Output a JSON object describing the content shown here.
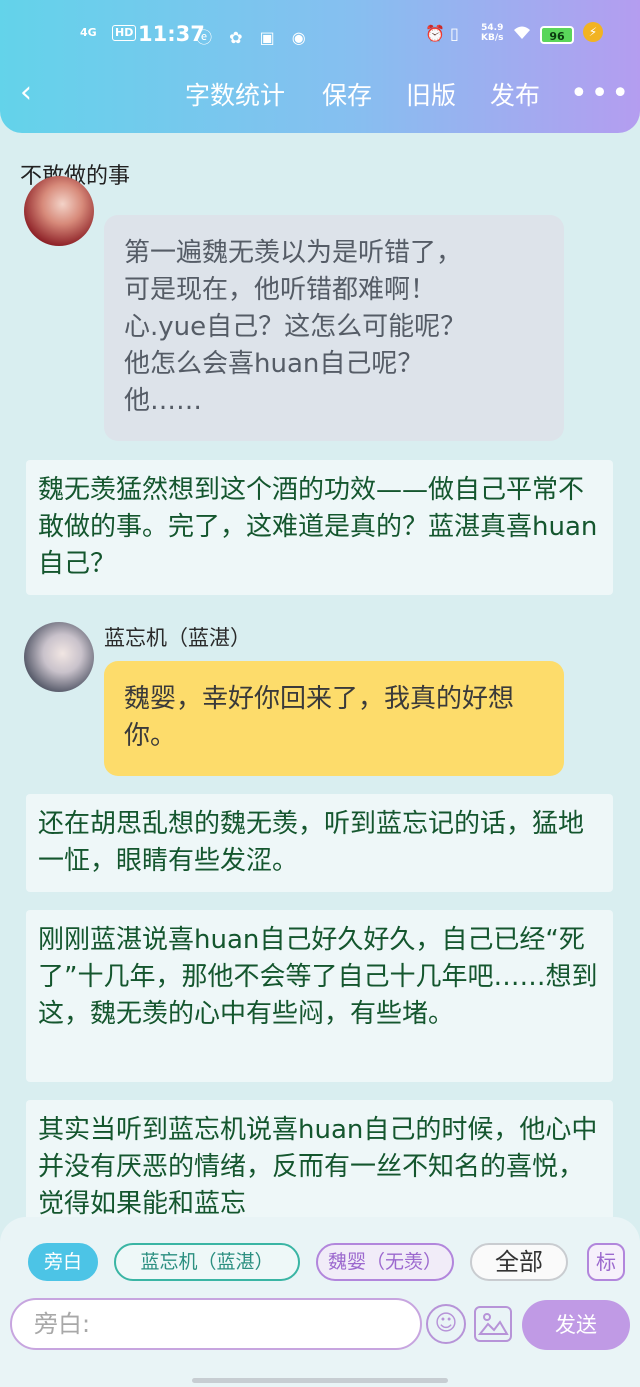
{
  "status_bar": {
    "network": "4G",
    "hd": "HD",
    "time": "11:37",
    "app_icons": "ⓔ ✿ ▣ ◉",
    "speed_value": "54.9",
    "speed_unit": "KB/s",
    "battery": "96"
  },
  "header": {
    "back_icon": "‹",
    "word_count": "字数统计",
    "save": "保存",
    "old_version": "旧版",
    "publish": "发布",
    "more_icon": "•••"
  },
  "document": {
    "title": "不敢做的事"
  },
  "messages": {
    "gray_bubble": "第一遍魏无羡以为是听错了，\n可是现在，他听错都难啊！\n心.yue自己？这怎么可能呢？\n他怎么会喜huan自己呢？\n他……",
    "narration_1": "魏无羡猛然想到这个酒的功效——做自己平常不敢做的事。完了，这难道是真的？蓝湛真喜huan自己？",
    "speaker_2": "蓝忘机（蓝湛）",
    "yellow_bubble": "魏婴，幸好你回来了，我真的好想你。",
    "narration_2": "还在胡思乱想的魏无羡，听到蓝忘记的话，猛地一怔，眼睛有些发涩。",
    "narration_3": "刚刚蓝湛说喜huan自己好久好久，自己已经“死了”十几年，那他不会等了自己十几年吧……想到这，魏无羡的心中有些闷，有些堵。",
    "narration_4": "其实当听到蓝忘机说喜huan自己的时候，他心中并没有厌恶的情绪，反而有一丝不知名的喜悦，觉得如果能和蓝忘"
  },
  "composer": {
    "chip_narrator": "旁白",
    "chip_lanwangji": "蓝忘机（蓝湛）",
    "chip_weiying": "魏婴（无羡）",
    "chip_all": "全部",
    "chip_mark": "标",
    "input_placeholder": "旁白:",
    "emoji_icon": "☺",
    "send": "发送"
  }
}
